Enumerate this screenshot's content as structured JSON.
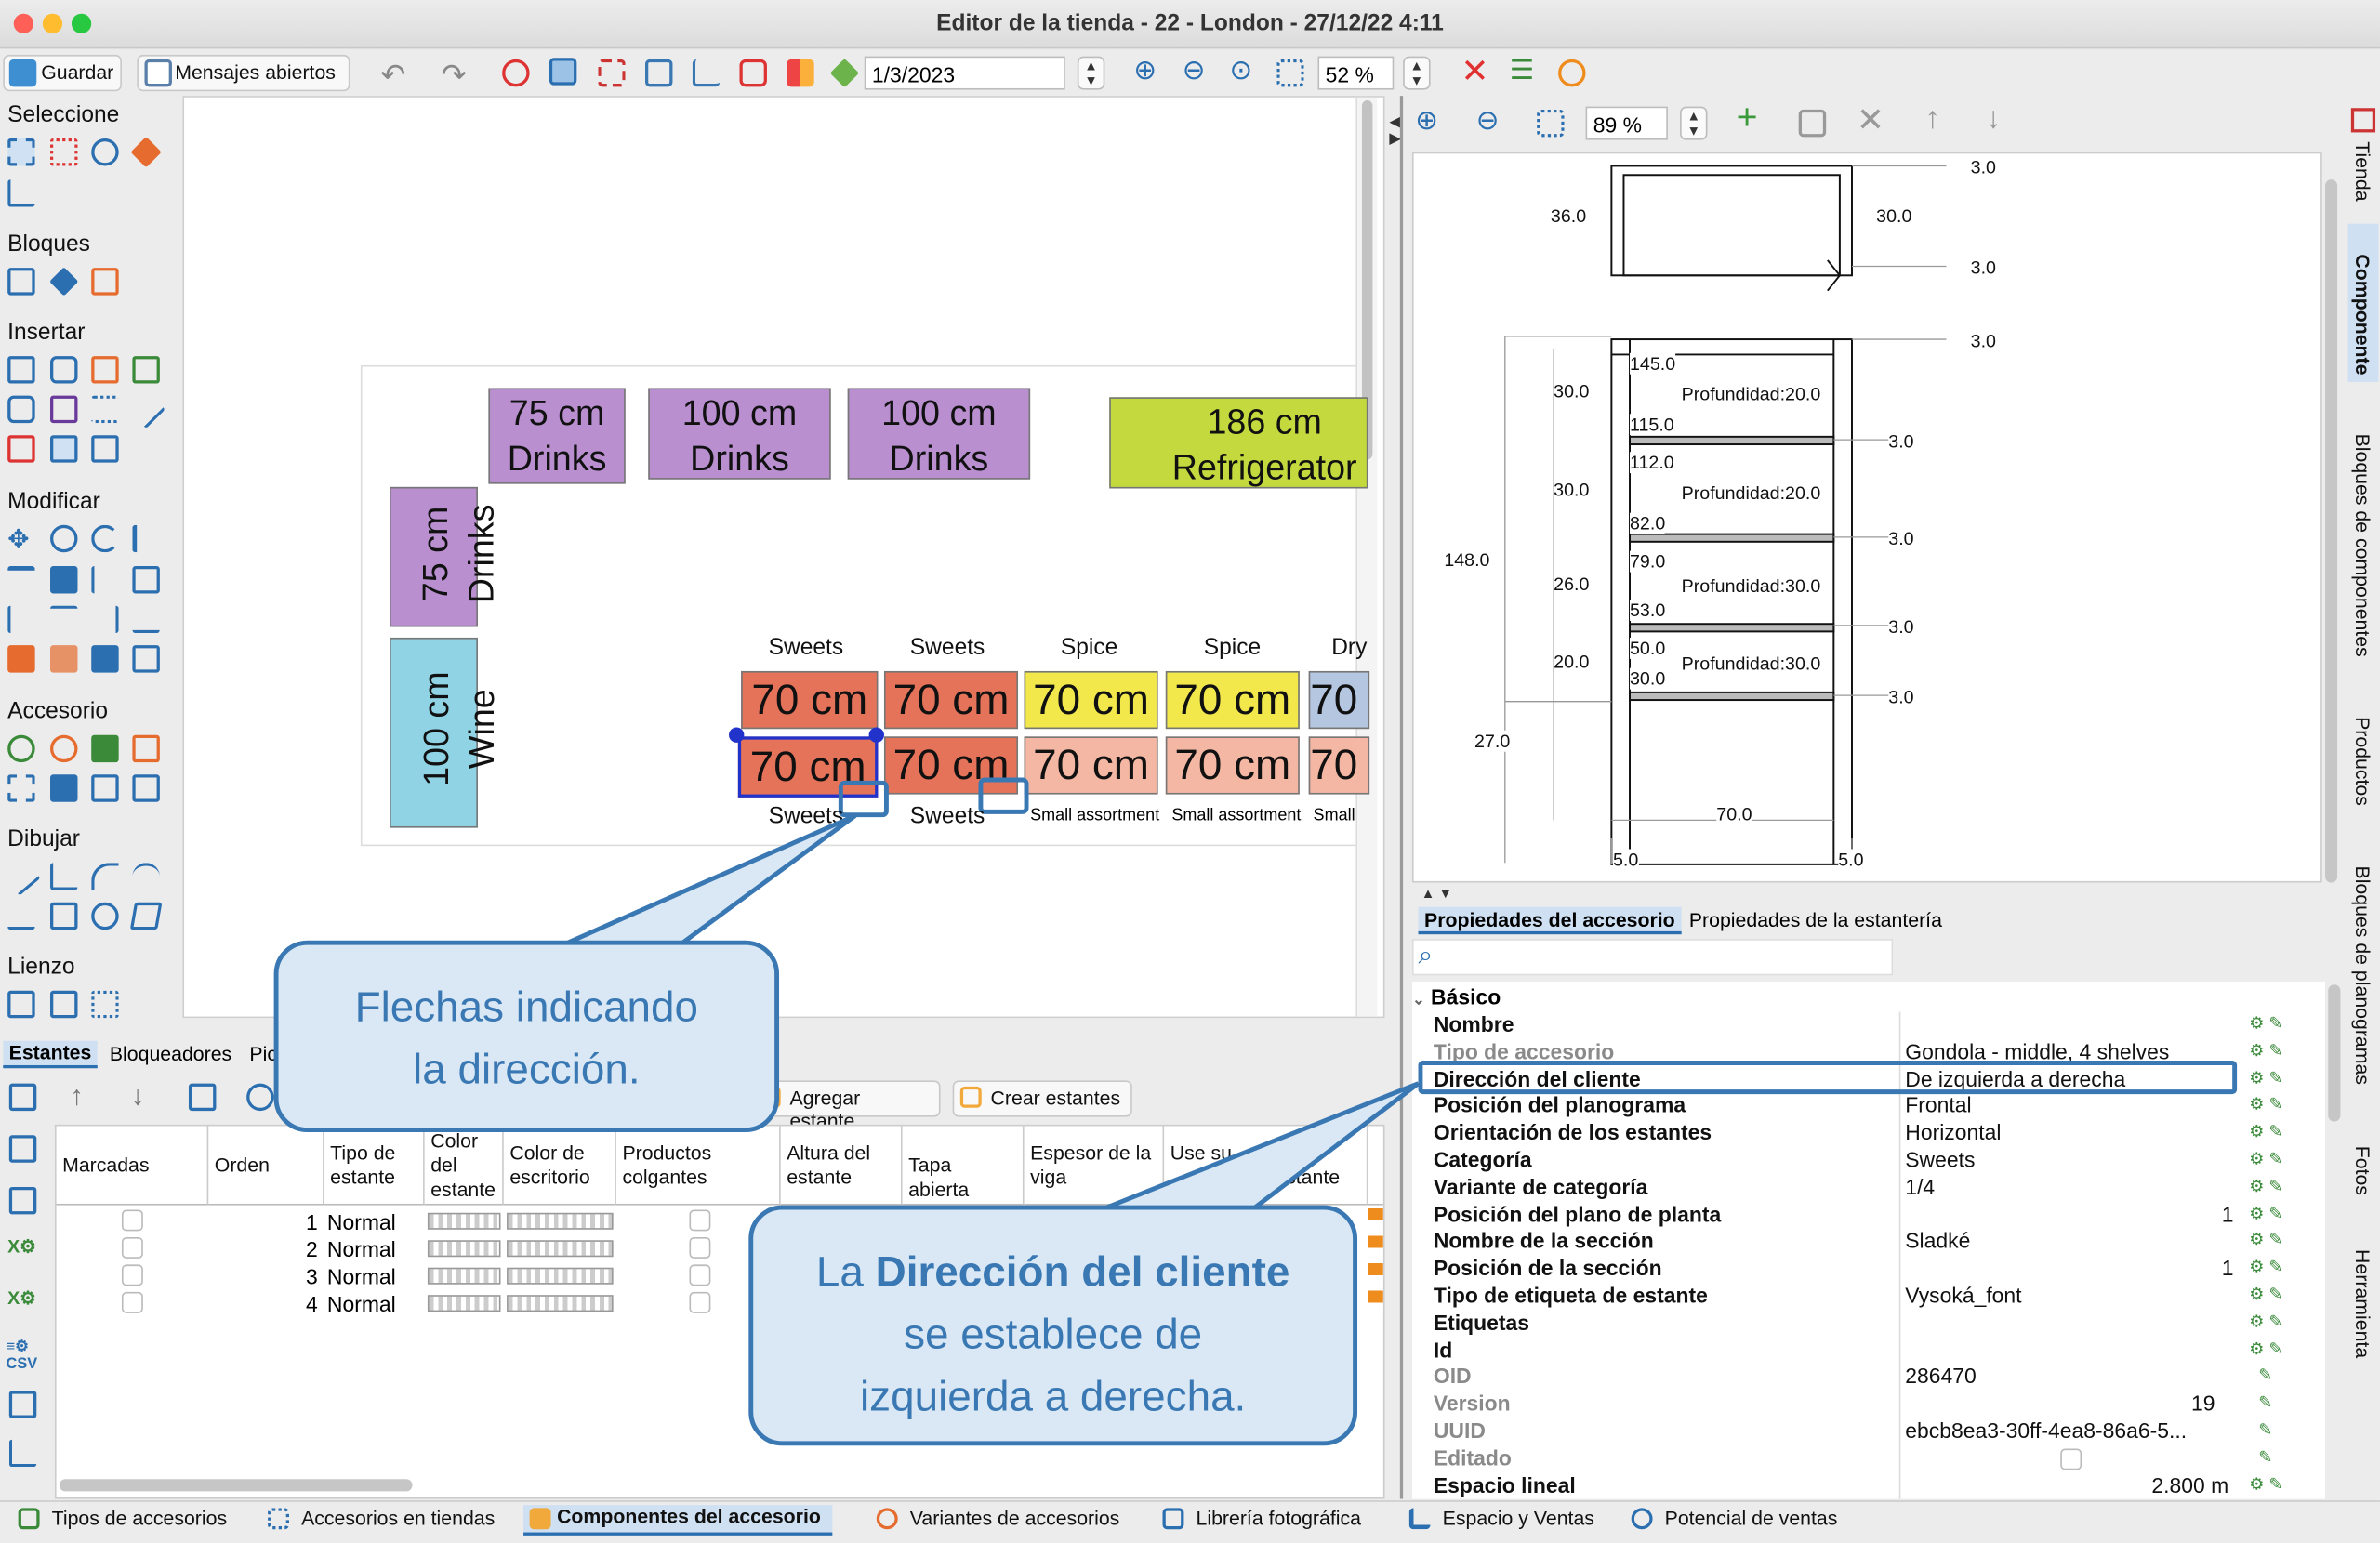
{
  "window": {
    "title": "Editor de la tienda - 22 - London - 27/12/22 4:11"
  },
  "toolbar": {
    "save": "Guardar",
    "messages": "Mensajes abiertos",
    "date": "1/3/2023",
    "zoom": "52 %"
  },
  "palette": {
    "sections": [
      "Seleccione",
      "Bloques",
      "Insertar",
      "Modificar",
      "Accesorio",
      "Dibujar",
      "Lienzo"
    ]
  },
  "canvas": {
    "fixtures": [
      {
        "size": "75 cm",
        "name": "Drinks",
        "color": "#b98fd0"
      },
      {
        "size": "100 cm",
        "name": "Drinks",
        "color": "#b98fd0"
      },
      {
        "size": "100 cm",
        "name": "Drinks",
        "color": "#b98fd0"
      },
      {
        "size": "186 cm",
        "name": "Refrigerator",
        "color": "#c3d93e"
      },
      {
        "size": "75 cm",
        "name": "Drinks",
        "color": "#b98fd0"
      },
      {
        "size": "100 cm",
        "name": "Wine",
        "color": "#8fd3e4"
      }
    ],
    "top_labels": [
      "Sweets",
      "Sweets",
      "Spice",
      "Spice",
      "Dry"
    ],
    "row_text": "70 cm",
    "row_partial": "70",
    "bottom_labels": [
      "Sweets",
      "Sweets",
      "Small assortment",
      "Small assortment",
      "Small"
    ]
  },
  "callouts": {
    "arrows_line1": "Flechas indicando",
    "arrows_line2": "la dirección.",
    "dir_pre": "La ",
    "dir_bold": "Dirección del cliente",
    "dir_line2": "se establece de",
    "dir_line3": "izquierda a derecha."
  },
  "right_toolbar": {
    "zoom": "89 %"
  },
  "drawing": {
    "dims": [
      "3.0",
      "36.0",
      "30.0",
      "3.0",
      "3.0",
      "30.0",
      "3.0",
      "30.0",
      "3.0",
      "148.0",
      "26.0",
      "3.0",
      "20.0",
      "3.0",
      "27.0",
      "70.0",
      "5.0",
      "5.0"
    ],
    "shelves": [
      {
        "top": "145.0",
        "depth": "Profundidad:20.0",
        "bottom": "115.0"
      },
      {
        "top": "112.0",
        "depth": "Profundidad:20.0",
        "bottom": "82.0"
      },
      {
        "top": "79.0",
        "depth": "Profundidad:30.0",
        "bottom": "53.0"
      },
      {
        "top": "50.0",
        "depth": "Profundidad:30.0",
        "bottom": "30.0"
      }
    ]
  },
  "side_tabs": [
    "Tienda",
    "Componente",
    "Bloques de componentes",
    "Productos",
    "Bloques de planogramas",
    "Fotos",
    "Herramienta"
  ],
  "props_tabs": [
    "Propiedades del accesorio",
    "Propiedades de la estantería"
  ],
  "props": {
    "group": "Básico",
    "rows": [
      {
        "name": "Nombre",
        "value": ""
      },
      {
        "name": "Tipo de accesorio",
        "value": "Gondola - middle, 4 shelves",
        "gray": true
      },
      {
        "name": "Dirección del cliente",
        "value": "De izquierda a derecha"
      },
      {
        "name": "Posición del planograma",
        "value": "Frontal"
      },
      {
        "name": "Orientación de los estantes",
        "value": "Horizontal"
      },
      {
        "name": "Categoría",
        "value": "Sweets"
      },
      {
        "name": "Variante de categoría",
        "value": "1/4"
      },
      {
        "name": "Posición del plano de planta",
        "value": "1",
        "right": true
      },
      {
        "name": "Nombre de la sección",
        "value": "Sladké"
      },
      {
        "name": "Posición de la sección",
        "value": "1",
        "right": true
      },
      {
        "name": "Tipo de etiqueta de estante",
        "value": "Vysoká_font"
      },
      {
        "name": "Etiquetas",
        "value": ""
      },
      {
        "name": "Id",
        "value": ""
      },
      {
        "name": "OID",
        "value": "286470",
        "gray": true
      },
      {
        "name": "Version",
        "value": "19",
        "gray": true,
        "right": true
      },
      {
        "name": "UUID",
        "value": "ebcb8ea3-30ff-4ea8-86a6-5...",
        "gray": true
      },
      {
        "name": "Editado",
        "value": "",
        "gray": true
      },
      {
        "name": "Espacio lineal",
        "value": "2.800 m",
        "right": true
      }
    ]
  },
  "lower_tabs": [
    "Estantes",
    "Bloqueadores",
    "Pic"
  ],
  "lower_toolbar": {
    "add_shelf": "Agregar estante",
    "create_shelves": "Crear estantes"
  },
  "table": {
    "headers": [
      "Marcadas",
      "Orden",
      "Tipo de estante",
      "Color del estante",
      "Color de escritorio",
      "Productos colgantes",
      "Altura del estante",
      "Tapa abierta",
      "Espesor de la viga",
      "Use su",
      "stante"
    ],
    "rows": [
      {
        "order": "1",
        "type": "Normal"
      },
      {
        "order": "2",
        "type": "Normal"
      },
      {
        "order": "3",
        "type": "Normal"
      },
      {
        "order": "4",
        "type": "Normal"
      }
    ]
  },
  "bottom_tabs": [
    "Tipos de accesorios",
    "Accesorios en tiendas",
    "Componentes del accesorio",
    "Variantes de accesorios",
    "Librería fotográfica",
    "Espacio y Ventas",
    "Potencial de ventas"
  ],
  "colors": {
    "accent": "#3a78b4",
    "sweets": "#e5735a",
    "sweets_light": "#f3b7a3",
    "spice": "#f2e84c",
    "dry": "#b5c7e0"
  }
}
